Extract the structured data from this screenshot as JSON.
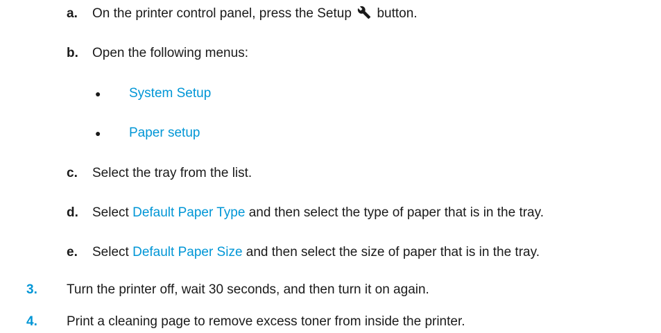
{
  "sub_steps": [
    {
      "marker": "a.",
      "pre": "On the printer control panel, press the Setup",
      "post": "button.",
      "icon": "wrench-icon"
    },
    {
      "marker": "b.",
      "text": "Open the following menus:"
    },
    {
      "marker": "c.",
      "text": "Select the tray from the list."
    },
    {
      "marker": "d.",
      "pre": "Select",
      "link": "Default Paper Type",
      "post": "and then select the type of paper that is in the tray."
    },
    {
      "marker": "e.",
      "pre": "Select",
      "link": "Default Paper Size",
      "post": "and then select the size of paper that is in the tray."
    }
  ],
  "menus": [
    {
      "bullet": "●",
      "label": "System Setup"
    },
    {
      "bullet": "●",
      "label": "Paper setup"
    }
  ],
  "steps": [
    {
      "number": "3.",
      "text": "Turn the printer off, wait 30 seconds, and then turn it on again."
    },
    {
      "number": "4.",
      "text": "Print a cleaning page to remove excess toner from inside the printer."
    }
  ],
  "colors": {
    "accent": "#0096d6",
    "text": "#1a1a1a"
  }
}
